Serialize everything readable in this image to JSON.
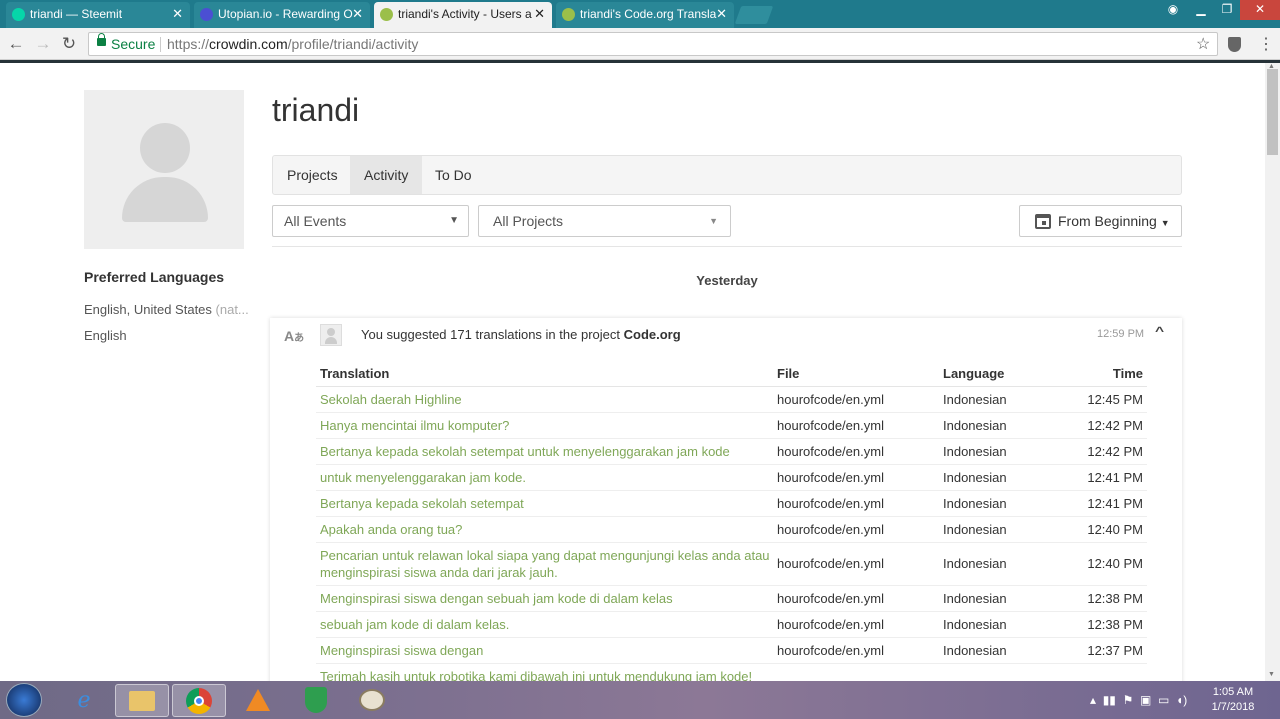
{
  "browser": {
    "tabs": [
      {
        "title": "triandi — Steemit",
        "active": false,
        "favicon_color": "#06d6a9"
      },
      {
        "title": "Utopian.io - Rewarding O",
        "active": false,
        "favicon_color": "#4b4fd3"
      },
      {
        "title": "triandi's Activity - Users a",
        "active": true,
        "favicon_color": "#9bbf4a"
      },
      {
        "title": "triandi's Code.org Transla",
        "active": false,
        "favicon_color": "#9bbf4a"
      }
    ],
    "secure_label": "Secure",
    "url_scheme": "https://",
    "url_host": "crowdin.com",
    "url_path": "/profile/triandi/activity"
  },
  "profile": {
    "username": "triandi",
    "preferred_languages_title": "Preferred Languages",
    "languages": [
      {
        "name": "English, United States",
        "note": "(nat..."
      },
      {
        "name": "English",
        "note": ""
      }
    ]
  },
  "tabs": [
    {
      "label": "Projects",
      "active": false
    },
    {
      "label": "Activity",
      "active": true
    },
    {
      "label": "To Do",
      "active": false
    }
  ],
  "filters": {
    "events": "All Events",
    "projects": "All Projects",
    "date": "From Beginning"
  },
  "day_heading": "Yesterday",
  "event": {
    "text_prefix": "You suggested 171 translations in the project",
    "project": "Code.org",
    "time": "12:59 PM"
  },
  "table": {
    "headers": [
      "Translation",
      "File",
      "Language",
      "Time"
    ],
    "rows": [
      {
        "translation": "Sekolah daerah Highline",
        "file": "hourofcode/en.yml",
        "language": "Indonesian",
        "time": "12:45 PM"
      },
      {
        "translation": "Hanya mencintai ilmu komputer?",
        "file": "hourofcode/en.yml",
        "language": "Indonesian",
        "time": "12:42 PM"
      },
      {
        "translation": "Bertanya kepada sekolah setempat untuk menyelenggarakan jam kode",
        "file": "hourofcode/en.yml",
        "language": "Indonesian",
        "time": "12:42 PM"
      },
      {
        "translation": "untuk menyelenggarakan jam kode.",
        "file": "hourofcode/en.yml",
        "language": "Indonesian",
        "time": "12:41 PM"
      },
      {
        "translation": "Bertanya kepada sekolah setempat",
        "file": "hourofcode/en.yml",
        "language": "Indonesian",
        "time": "12:41 PM"
      },
      {
        "translation": "Apakah anda orang tua?",
        "file": "hourofcode/en.yml",
        "language": "Indonesian",
        "time": "12:40 PM"
      },
      {
        "translation": "Pencarian untuk relawan lokal siapa yang dapat mengunjungi kelas anda atau menginspirasi siswa anda dari jarak jauh.",
        "file": "hourofcode/en.yml",
        "language": "Indonesian",
        "time": "12:40 PM"
      },
      {
        "translation": "Menginspirasi siswa dengan sebuah jam kode di dalam kelas",
        "file": "hourofcode/en.yml",
        "language": "Indonesian",
        "time": "12:38 PM"
      },
      {
        "translation": "sebuah jam kode di dalam kelas.",
        "file": "hourofcode/en.yml",
        "language": "Indonesian",
        "time": "12:38 PM"
      },
      {
        "translation": "Menginspirasi siswa dengan",
        "file": "hourofcode/en.yml",
        "language": "Indonesian",
        "time": "12:37 PM"
      },
      {
        "translation": "Terimah kasih untuk robotika kami dibawah ini untuk mendukung jam kode!",
        "file": "",
        "language": "",
        "time": ""
      }
    ]
  },
  "taskbar": {
    "apps": [
      "windows-start",
      "internet-explorer",
      "file-explorer",
      "chrome",
      "vlc",
      "shield-app",
      "paint"
    ],
    "clock_time": "1:05 AM",
    "clock_date": "1/7/2018"
  }
}
